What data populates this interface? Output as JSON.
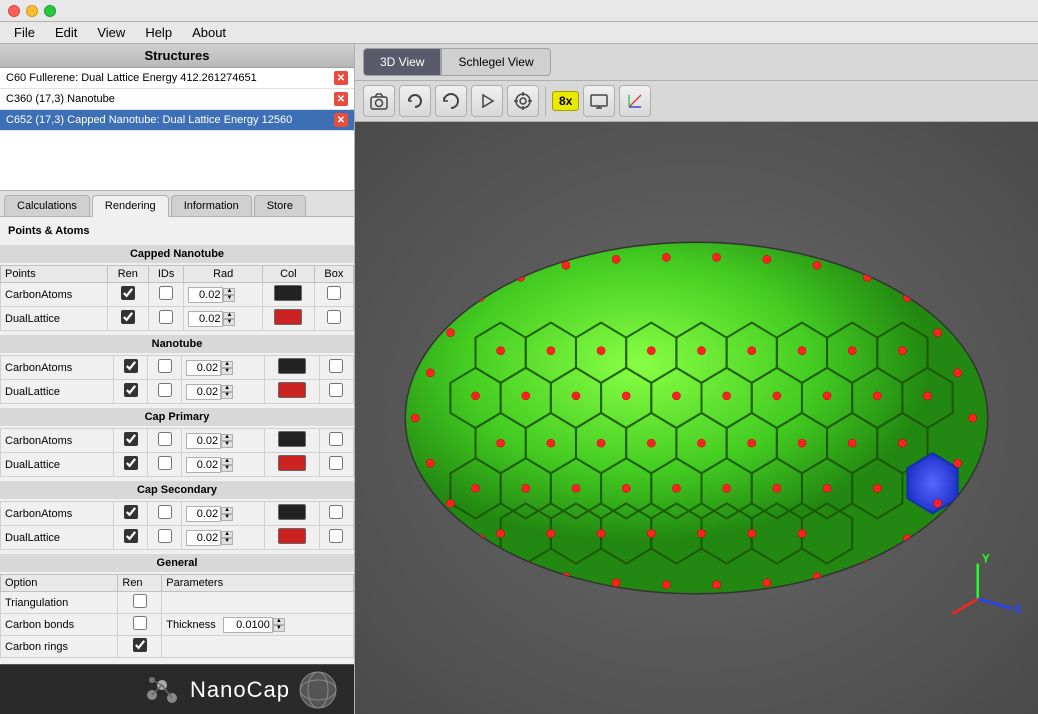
{
  "window": {
    "title": "NanoCap"
  },
  "menubar": {
    "items": [
      "File",
      "Edit",
      "View",
      "Help",
      "About"
    ]
  },
  "left_panel": {
    "structures_header": "Structures",
    "structures": [
      {
        "label": "C60 Fullerene: Dual Lattice Energy 412.261274651",
        "selected": false
      },
      {
        "label": "C360 (17,3) Nanotube",
        "selected": false
      },
      {
        "label": "C652 (17,3) Capped Nanotube: Dual Lattice Energy 12560",
        "selected": true
      }
    ],
    "tabs": [
      "Calculations",
      "Rendering",
      "Information",
      "Store"
    ],
    "active_tab": "Rendering",
    "points_atoms_label": "Points & Atoms",
    "sections": {
      "capped_nanotube": {
        "header": "Capped Nanotube",
        "columns": [
          "Points",
          "Ren",
          "IDs",
          "Rad",
          "Col",
          "Box"
        ],
        "rows": [
          {
            "name": "CarbonAtoms",
            "ren": true,
            "ids": false,
            "rad": "0.02",
            "col": "#222222",
            "box": false
          },
          {
            "name": "DualLattice",
            "ren": true,
            "ids": false,
            "rad": "0.02",
            "col": "#cc2222",
            "box": false
          }
        ]
      },
      "nanotube": {
        "header": "Nanotube",
        "rows": [
          {
            "name": "CarbonAtoms",
            "ren": true,
            "ids": false,
            "rad": "0.02",
            "col": "#222222",
            "box": false
          },
          {
            "name": "DualLattice",
            "ren": true,
            "ids": false,
            "rad": "0.02",
            "col": "#cc2222",
            "box": false
          }
        ]
      },
      "cap_primary": {
        "header": "Cap Primary",
        "rows": [
          {
            "name": "CarbonAtoms",
            "ren": true,
            "ids": false,
            "rad": "0.02",
            "col": "#222222",
            "box": false
          },
          {
            "name": "DualLattice",
            "ren": true,
            "ids": false,
            "rad": "0.02",
            "col": "#cc2222",
            "box": false
          }
        ]
      },
      "cap_secondary": {
        "header": "Cap Secondary",
        "rows": [
          {
            "name": "CarbonAtoms",
            "ren": true,
            "ids": false,
            "rad": "0.02",
            "col": "#222222",
            "box": false
          },
          {
            "name": "DualLattice",
            "ren": true,
            "ids": false,
            "rad": "0.02",
            "col": "#cc2222",
            "box": false
          }
        ]
      },
      "general": {
        "header": "General",
        "col_option": "Option",
        "col_ren": "Ren",
        "col_params": "Parameters",
        "rows": [
          {
            "name": "Triangulation",
            "ren": false,
            "params": ""
          },
          {
            "name": "Carbon bonds",
            "ren": false,
            "params": "Thickness 0.0100"
          },
          {
            "name": "Carbon rings",
            "ren": true,
            "params": ""
          }
        ],
        "thickness_label": "Thickness",
        "thickness_value": "0.0100"
      }
    }
  },
  "right_panel": {
    "toolbar": {
      "buttons": [
        {
          "name": "camera",
          "icon": "📷"
        },
        {
          "name": "rotate",
          "icon": "🔄"
        },
        {
          "name": "refresh",
          "icon": "↺"
        },
        {
          "name": "play",
          "icon": "▷"
        },
        {
          "name": "target",
          "icon": "◎"
        }
      ],
      "badge": "8x",
      "screen_btn": "🖥",
      "axes_btn": "✛"
    },
    "view_tabs": [
      "3D View",
      "Schlegel View"
    ],
    "active_view": "3D View"
  },
  "footer": {
    "logo": "NanoCap"
  }
}
